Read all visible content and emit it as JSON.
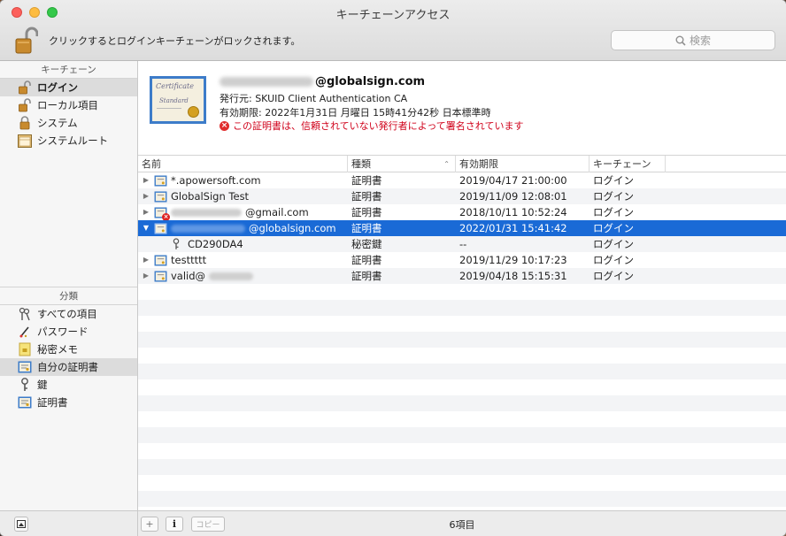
{
  "window": {
    "title": "キーチェーンアクセス"
  },
  "toolbar": {
    "lock_text": "クリックするとログインキーチェーンがロックされます。",
    "search_placeholder": "検索"
  },
  "sidebar": {
    "keychains_header": "キーチェーン",
    "keychains": [
      {
        "label": "ログイン",
        "icon": "unlocked-padlock-icon",
        "selected": true
      },
      {
        "label": "ローカル項目",
        "icon": "unlocked-padlock-icon",
        "selected": false
      },
      {
        "label": "システム",
        "icon": "padlock-icon",
        "selected": false
      },
      {
        "label": "システムルート",
        "icon": "cabinet-icon",
        "selected": false
      }
    ],
    "categories_header": "分類",
    "categories": [
      {
        "label": "すべての項目",
        "icon": "all-items-icon",
        "selected": false
      },
      {
        "label": "パスワード",
        "icon": "password-icon",
        "selected": false
      },
      {
        "label": "秘密メモ",
        "icon": "secure-note-icon",
        "selected": false
      },
      {
        "label": "自分の証明書",
        "icon": "my-certificate-icon",
        "selected": true
      },
      {
        "label": "鍵",
        "icon": "key-icon",
        "selected": false
      },
      {
        "label": "証明書",
        "icon": "certificate-icon",
        "selected": false
      }
    ]
  },
  "detail": {
    "title_suffix": "@globalsign.com",
    "issuer": "発行元: SKUID Client Authentication CA",
    "expiry": "有効期限: 2022年1月31日 月曜日 15時41分42秒 日本標準時",
    "warning": "この証明書は、信頼されていない発行者によって署名されています",
    "cert_image_text": [
      "Certificate",
      "Standard"
    ]
  },
  "table": {
    "columns": [
      "名前",
      "種類",
      "有効期限",
      "キーチェーン"
    ],
    "rows": [
      {
        "name": "*.apowersoft.com",
        "kind": "証明書",
        "date": "2019/04/17 21:00:00",
        "keychain": "ログイン",
        "icon": "certificate-icon",
        "expandable": true
      },
      {
        "name": "GlobalSign Test",
        "kind": "証明書",
        "date": "2019/11/09 12:08:01",
        "keychain": "ログイン",
        "icon": "certificate-icon",
        "expandable": true
      },
      {
        "name": "@gmail.com",
        "kind": "証明書",
        "date": "2018/10/11 10:52:24",
        "keychain": "ログイン",
        "icon": "certificate-invalid-icon",
        "expandable": true
      },
      {
        "name": "@globalsign.com",
        "kind": "証明書",
        "date": "2022/01/31 15:41:42",
        "keychain": "ログイン",
        "icon": "certificate-icon",
        "expandable": true,
        "expanded": true,
        "selected": true
      },
      {
        "name": "CD290DA4",
        "kind": "秘密鍵",
        "date": "--",
        "keychain": "ログイン",
        "icon": "key-icon",
        "child": true
      },
      {
        "name": "testtttt",
        "kind": "証明書",
        "date": "2019/11/29 10:17:23",
        "keychain": "ログイン",
        "icon": "certificate-icon",
        "expandable": true
      },
      {
        "name": "valid@",
        "kind": "証明書",
        "date": "2019/04/18 15:15:31",
        "keychain": "ログイン",
        "icon": "certificate-icon",
        "expandable": true
      }
    ]
  },
  "statusbar": {
    "count": "6項目",
    "add_label": "+",
    "info_label": "i",
    "copy_label": "コピー"
  },
  "colors": {
    "selection": "#1a6ad6",
    "warning": "#d0021b"
  }
}
